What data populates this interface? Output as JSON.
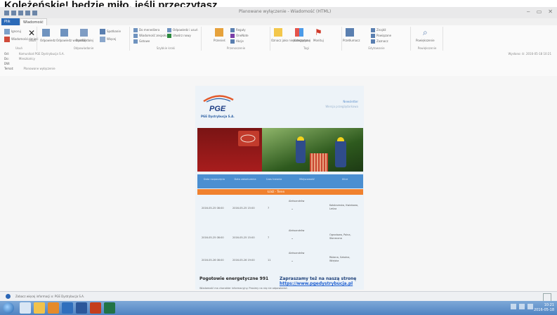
{
  "heading": "Koleżeńskie! będzie miło, jeśli przeczytasz",
  "window": {
    "title": "Planowane wyłączenie - Wiadomość (HTML)",
    "controls": [
      "‒",
      "▭",
      "✕"
    ]
  },
  "tabs": {
    "file": "Plik",
    "active": "Wiadomość"
  },
  "ribbon": {
    "groups": [
      "Usuń",
      "Odpowiadanie",
      "Szybkie kroki",
      "Przenoszenie",
      "Tagi",
      "Edytowanie",
      "Powiększenie"
    ],
    "buttons": {
      "ignore": "Ignoruj",
      "junk": "Wiadomości-śmieci",
      "delete": "Usuń",
      "reply": "Odpowiedz",
      "reply_all": "Odpowiedz wszystkim",
      "forward": "Prześlij dalej",
      "meeting": "Spotkanie",
      "more": "Więcej",
      "to_manager": "Do menedżera",
      "team_email": "Wiadomość zespołu",
      "done": "Gotowe",
      "reply_delete": "Odpowiedz i usuń",
      "create_new": "Utwórz nowy",
      "move": "Przenieś",
      "rules": "Reguły",
      "actions": "Akcje",
      "onenote": "OneNote",
      "mark_unread": "Oznacz jako nieprzeczytane",
      "categorize": "Kategoryzuj",
      "follow_up": "Monituj",
      "translate": "Przetłumacz",
      "find": "Znajdź",
      "related": "Powiązane",
      "select": "Zaznacz",
      "zoom": "Powiększenie"
    }
  },
  "message_header": {
    "from_label": "Od:",
    "from_value": "Komunikat PGE Dystrybucja S.A.",
    "to_label": "Do:",
    "to_value": "Mieszkańcy",
    "cc_label": "DW:",
    "cc_value": "",
    "subject_label": "Temat:",
    "subject_value": "Planowane wyłączenie",
    "date": "Wysłano: śr. 2016-05-18 10:21"
  },
  "email": {
    "logo_text": "PGE",
    "company": "PGE Dystrybucja S.A.",
    "link_top": "Newsletter",
    "link_sub": "Wersja przeglądarkowa",
    "columns": [
      "Data rozpoczęcia",
      "Data zakończenia",
      "Czas trwania",
      "Miejscowość",
      "Ulice"
    ],
    "orange_bar": "Łódź - Teren",
    "rows": [
      {
        "start": "2016-05-25 08:00",
        "end": "2016-05-25 15:00",
        "hours": "7",
        "locality": "Aleksandrów",
        "streets": "Kołobrzeska, Kwiatowa, Leśna"
      },
      {
        "start": "2016-05-25 08:00",
        "end": "2016-05-25 15:00",
        "hours": "7",
        "locality": "Aleksandrów",
        "streets": "Ogrodowa, Polna, Słoneczna"
      },
      {
        "start": "2016-05-26 08:00",
        "end": "2016-05-26 19:00",
        "hours": "11",
        "locality": "Aleksandrów",
        "streets": "Różana, Szkolna, Wiejska"
      }
    ],
    "footer_left": "Pogotowie energetyczne 991",
    "footer_right_text": "Zapraszamy też na naszą stronę",
    "footer_right_link": "https://www.pgedystrybucja.pl",
    "bottom_note": "Wiadomość ma charakter informacyjny. Prosimy na nią nie odpowiadać."
  },
  "status_bar": {
    "text": "Zobacz więcej informacji o: PGE Dystrybucja S.A."
  },
  "taskbar": {
    "time": "10:21",
    "date": "2016-05-18"
  },
  "colors": {
    "accent": "#2c6bb8",
    "table_header": "#4b8fd1",
    "orange_bar": "#f0812e",
    "email_bg": "#edf3f8"
  }
}
